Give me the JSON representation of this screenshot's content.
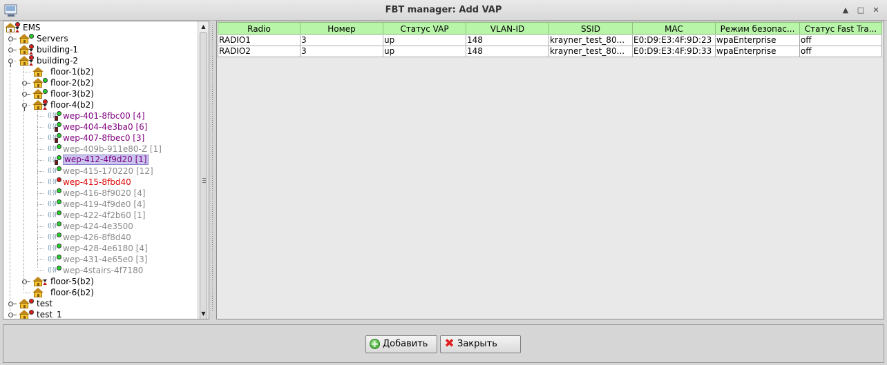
{
  "window": {
    "title": "FBT manager: Add VAP"
  },
  "tree": {
    "nodes": [
      {
        "label": "EMS"
      },
      {
        "label": "Servers"
      },
      {
        "label": "building-1"
      },
      {
        "label": "building-2"
      },
      {
        "label": "floor-1(b2)"
      },
      {
        "label": "floor-2(b2)"
      },
      {
        "label": "floor-3(b2)"
      },
      {
        "label": "floor-4(b2)"
      },
      {
        "label": "wep-401-8fbc00 [4]"
      },
      {
        "label": "wep-404-4e3ba0 [6]"
      },
      {
        "label": "wep-407-8fbec0 [3]"
      },
      {
        "label": "wep-409b-911e80-Z [1]"
      },
      {
        "label": "wep-412-4f9d20 [1]"
      },
      {
        "label": "wep-415-170220 [12]"
      },
      {
        "label": "wep-415-8fbd40"
      },
      {
        "label": "wep-416-8f9020 [4]"
      },
      {
        "label": "wep-419-4f9de0 [4]"
      },
      {
        "label": "wep-422-4f2b60 [1]"
      },
      {
        "label": "wep-424-4e3500"
      },
      {
        "label": "wep-426-8f8d40"
      },
      {
        "label": "wep-428-4e6180 [4]"
      },
      {
        "label": "wep-431-4e65e0 [3]"
      },
      {
        "label": "wep-4stairs-4f7180"
      },
      {
        "label": "floor-5(b2)"
      },
      {
        "label": "floor-6(b2)"
      },
      {
        "label": "test"
      },
      {
        "label": "test_1"
      }
    ]
  },
  "table": {
    "headers": [
      "Radio",
      "Номер",
      "Статус VAP",
      "VLAN-ID",
      "SSID",
      "MAC",
      "Режим безопас...",
      "Статус Fast Tra..."
    ],
    "rows": [
      [
        "RADIO1",
        "3",
        "up",
        "148",
        "krayner_test_80...",
        "E0:D9:E3:4F:9D:23",
        "wpaEnterprise",
        "off"
      ],
      [
        "RADIO2",
        "3",
        "up",
        "148",
        "krayner_test_80...",
        "E0:D9:E3:4F:9D:33",
        "wpaEnterprise",
        "off"
      ]
    ]
  },
  "buttons": {
    "add_label": "Добавить",
    "close_label": "Закрыть"
  },
  "colors": {
    "header_bg": "#b8f5a8",
    "selected_bg": "#c9c5ef",
    "status_ok": "#22d22a",
    "status_err": "#e61b1b",
    "ap_purple": "#800080",
    "ap_gray": "#8a8a8a",
    "ap_red": "#e00000"
  }
}
